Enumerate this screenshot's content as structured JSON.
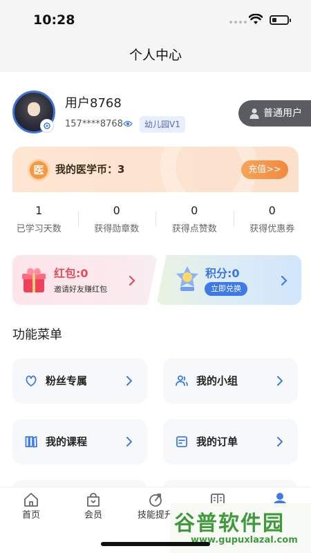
{
  "status_bar": {
    "time": "10:28"
  },
  "header": {
    "title": "个人中心"
  },
  "profile": {
    "username": "用户8768",
    "phone": "157****8768",
    "level": "幼儿园V1",
    "user_type": "普通用户"
  },
  "coin": {
    "label": "我的医学币：",
    "value": "3",
    "icon_text": "医",
    "recharge": "充值>>"
  },
  "stats": [
    {
      "value": "1",
      "label": "已学习天数"
    },
    {
      "value": "0",
      "label": "获得勋章数"
    },
    {
      "value": "0",
      "label": "获得点赞数"
    },
    {
      "value": "0",
      "label": "获得优惠券"
    }
  ],
  "promos": {
    "red_packet": {
      "title": "红包:0",
      "subtitle": "邀请好友赚红包"
    },
    "points": {
      "title": "积分:0",
      "button": "立即兑换"
    }
  },
  "menu": {
    "title": "功能菜单",
    "items": [
      {
        "label": "粉丝专属",
        "icon": "fans-icon"
      },
      {
        "label": "我的小组",
        "icon": "group-icon"
      },
      {
        "label": "我的课程",
        "icon": "course-icon"
      },
      {
        "label": "我的订单",
        "icon": "order-icon"
      }
    ]
  },
  "tabbar": {
    "items": [
      {
        "label": "首页",
        "icon": "home-icon"
      },
      {
        "label": "会员",
        "icon": "member-icon"
      },
      {
        "label": "技能提升",
        "icon": "skill-icon"
      },
      {
        "label": "",
        "icon": "book-icon"
      },
      {
        "label": "",
        "icon": "profile-icon"
      }
    ],
    "active_color": "#3d7ae8"
  },
  "watermark": {
    "text": "谷普软件园",
    "url": "www.gupuxlazal.com"
  },
  "colors": {
    "accent": "#3d7ae8",
    "orange": "#f28a3d",
    "red": "#e34b58"
  }
}
